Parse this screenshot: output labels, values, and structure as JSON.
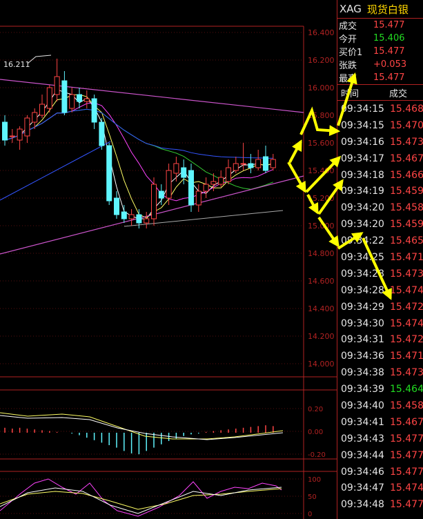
{
  "header": {
    "symbol": "XAG",
    "name": "现货白银"
  },
  "quote": [
    {
      "label": "成交",
      "value": "15.477",
      "color": "red"
    },
    {
      "label": "今开",
      "value": "15.406",
      "color": "green"
    },
    {
      "label": "买价1",
      "value": "15.477",
      "color": "red"
    },
    {
      "label": "张跌",
      "value": "+0.053",
      "color": "red"
    },
    {
      "label": "最高",
      "value": "15.477",
      "color": "red"
    }
  ],
  "ticks_header": {
    "time": "时间",
    "deal": "成交"
  },
  "ticks": [
    {
      "time": "09:34:15",
      "price": "15.468"
    },
    {
      "time": "09:34:15",
      "price": "15.470"
    },
    {
      "time": "09:34:16",
      "price": "15.473"
    },
    {
      "time": "09:34:17",
      "price": "15.467"
    },
    {
      "time": "09:34:18",
      "price": "15.466"
    },
    {
      "time": "09:34:19",
      "price": "15.459"
    },
    {
      "time": "09:34:20",
      "price": "15.458"
    },
    {
      "time": "09:34:20",
      "price": "15.459"
    },
    {
      "time": "09:34:22",
      "price": "15.465"
    },
    {
      "time": "09:34:25",
      "price": "15.471"
    },
    {
      "time": "09:34:28",
      "price": "15.473"
    },
    {
      "time": "09:34:28",
      "price": "15.474"
    },
    {
      "time": "09:34:29",
      "price": "15.472"
    },
    {
      "time": "09:34:30",
      "price": "15.474"
    },
    {
      "time": "09:34:31",
      "price": "15.472"
    },
    {
      "time": "09:34:36",
      "price": "15.471"
    },
    {
      "time": "09:34:38",
      "price": "15.473"
    },
    {
      "time": "09:34:39",
      "price": "15.464",
      "green": true
    },
    {
      "time": "09:34:40",
      "price": "15.458"
    },
    {
      "time": "09:34:41",
      "price": "15.467"
    },
    {
      "time": "09:34:43",
      "price": "15.477"
    },
    {
      "time": "09:34:44",
      "price": "15.477"
    },
    {
      "time": "09:34:46",
      "price": "15.477"
    },
    {
      "time": "09:34:47",
      "price": "15.474"
    },
    {
      "time": "09:34:48",
      "price": "15.477"
    }
  ],
  "price_axis": [
    "16.400",
    "16.200",
    "16.000",
    "15.800",
    "15.600",
    "15.400",
    "15.200",
    "15.000",
    "14.800",
    "14.600",
    "14.400",
    "14.200",
    "14.000"
  ],
  "macd_axis": [
    "0.20",
    "0.00",
    "-0.20"
  ],
  "kdj_axis": [
    "100",
    "50",
    "0"
  ],
  "high_label": "16.211",
  "colors": {
    "red": "#ff4545",
    "green": "#22dd22",
    "yellow": "#ffff00",
    "cyan": "#5ff5ff",
    "grid": "#b22222"
  },
  "chart_data": {
    "type": "candlestick",
    "ylim": [
      14.0,
      16.4
    ],
    "candles": [
      {
        "o": 15.75,
        "c": 15.62,
        "h": 15.8,
        "l": 15.58
      },
      {
        "o": 15.65,
        "c": 15.65,
        "h": 15.7,
        "l": 15.6
      },
      {
        "o": 15.62,
        "c": 15.7,
        "h": 15.72,
        "l": 15.55
      },
      {
        "o": 15.65,
        "c": 15.78,
        "h": 15.8,
        "l": 15.6
      },
      {
        "o": 15.75,
        "c": 15.82,
        "h": 15.85,
        "l": 15.7
      },
      {
        "o": 15.8,
        "c": 15.88,
        "h": 15.95,
        "l": 15.78
      },
      {
        "o": 15.85,
        "c": 16.0,
        "h": 16.02,
        "l": 15.82
      },
      {
        "o": 15.95,
        "c": 16.08,
        "h": 16.21,
        "l": 15.9
      },
      {
        "o": 16.05,
        "c": 15.82,
        "h": 16.12,
        "l": 15.8
      },
      {
        "o": 15.85,
        "c": 15.95,
        "h": 16.0,
        "l": 15.82
      },
      {
        "o": 15.95,
        "c": 15.9,
        "h": 16.0,
        "l": 15.85
      },
      {
        "o": 15.9,
        "c": 15.92,
        "h": 15.98,
        "l": 15.85
      },
      {
        "o": 15.92,
        "c": 15.75,
        "h": 15.95,
        "l": 15.7
      },
      {
        "o": 15.75,
        "c": 15.58,
        "h": 15.78,
        "l": 15.55
      },
      {
        "o": 15.58,
        "c": 15.18,
        "h": 15.6,
        "l": 15.15
      },
      {
        "o": 15.2,
        "c": 15.08,
        "h": 15.25,
        "l": 15.05
      },
      {
        "o": 15.1,
        "c": 15.05,
        "h": 15.15,
        "l": 15.02
      },
      {
        "o": 15.05,
        "c": 15.08,
        "h": 15.12,
        "l": 15.0
      },
      {
        "o": 15.08,
        "c": 15.02,
        "h": 15.12,
        "l": 14.98
      },
      {
        "o": 15.02,
        "c": 15.05,
        "h": 15.1,
        "l": 14.98
      },
      {
        "o": 15.05,
        "c": 15.3,
        "h": 15.35,
        "l": 15.0
      },
      {
        "o": 15.25,
        "c": 15.2,
        "h": 15.3,
        "l": 15.15
      },
      {
        "o": 15.2,
        "c": 15.4,
        "h": 15.45,
        "l": 15.15
      },
      {
        "o": 15.38,
        "c": 15.45,
        "h": 15.5,
        "l": 15.32
      },
      {
        "o": 15.42,
        "c": 15.35,
        "h": 15.48,
        "l": 15.3
      },
      {
        "o": 15.4,
        "c": 15.15,
        "h": 15.45,
        "l": 15.1
      },
      {
        "o": 15.15,
        "c": 15.25,
        "h": 15.3,
        "l": 15.1
      },
      {
        "o": 15.25,
        "c": 15.3,
        "h": 15.35,
        "l": 15.2
      },
      {
        "o": 15.3,
        "c": 15.32,
        "h": 15.38,
        "l": 15.25
      },
      {
        "o": 15.3,
        "c": 15.35,
        "h": 15.4,
        "l": 15.28
      },
      {
        "o": 15.32,
        "c": 15.42,
        "h": 15.48,
        "l": 15.3
      },
      {
        "o": 15.4,
        "c": 15.45,
        "h": 15.5,
        "l": 15.38
      },
      {
        "o": 15.45,
        "c": 15.45,
        "h": 15.6,
        "l": 15.4
      },
      {
        "o": 15.45,
        "c": 15.42,
        "h": 15.52,
        "l": 15.38
      },
      {
        "o": 15.42,
        "c": 15.48,
        "h": 15.55,
        "l": 15.4
      },
      {
        "o": 15.5,
        "c": 15.4,
        "h": 15.58,
        "l": 15.38
      },
      {
        "o": 15.42,
        "c": 15.48,
        "h": 15.52,
        "l": 15.4
      }
    ]
  }
}
